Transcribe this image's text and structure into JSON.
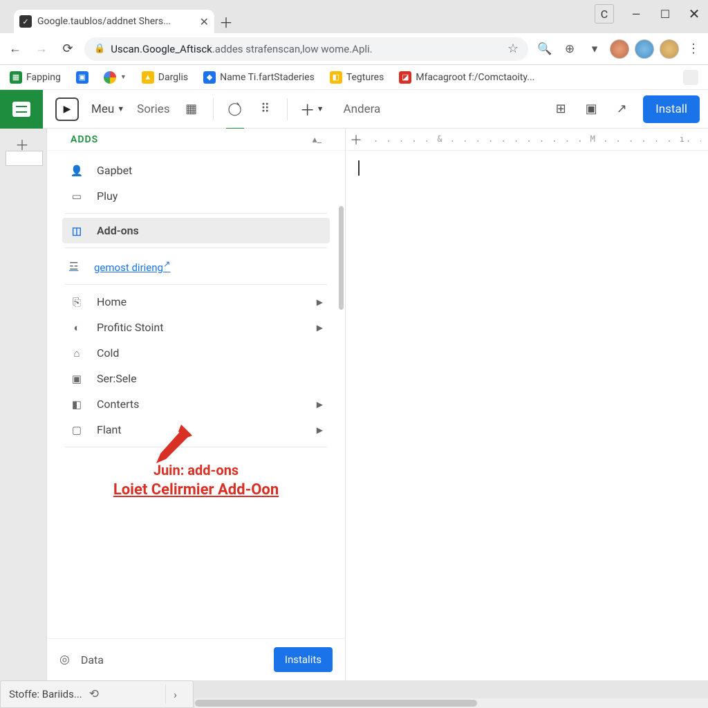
{
  "chrome": {
    "tab_title": "Google.taublos/addnet Shers...",
    "badge": "C",
    "url_prefix": "Uscan.Google_Aftisck",
    "url_suffix": ".addes strafenscan,low wome.Apli.",
    "bookmarks": [
      {
        "label": "Fapping",
        "bg": "#1e8e3e",
        "glyph": "▦"
      },
      {
        "label": "",
        "bg": "#1a73e8",
        "glyph": "▣"
      },
      {
        "label": "",
        "bg": "",
        "glyph": "G",
        "chev": true
      },
      {
        "label": "Darglis",
        "bg": "#fbbc04",
        "glyph": "▲"
      },
      {
        "label": "Name Ti.fartStaderies",
        "bg": "#1a73e8",
        "glyph": "◆"
      },
      {
        "label": "Tegtures",
        "bg": "#fbbc04",
        "glyph": "◧"
      },
      {
        "label": "Mfacagroot f:/Comctaoity...",
        "bg": "#d93025",
        "glyph": "◪"
      }
    ]
  },
  "toolbar": {
    "menu": "Meu",
    "sories": "Sories",
    "andera": "Andera",
    "install": "Install"
  },
  "panel": {
    "title": "ADDS",
    "items_top": [
      {
        "icon": "👤",
        "label": "Gapbet"
      },
      {
        "icon": "▭",
        "label": "Pluy"
      }
    ],
    "selected": {
      "icon": "◫",
      "label": "Add-ons"
    },
    "link": "gemost dirieng",
    "items": [
      {
        "icon": "⎘",
        "label": "Home",
        "chev": true
      },
      {
        "icon": "◐",
        "label": "Profitic Stoint",
        "chev": true
      },
      {
        "icon": "⌂",
        "label": "Cold",
        "chev": false
      },
      {
        "icon": "▣",
        "label": "Ser:Sele",
        "chev": false
      },
      {
        "icon": "◧",
        "label": "Conterts",
        "chev": true
      },
      {
        "icon": "▢",
        "label": "Flant",
        "chev": true
      }
    ],
    "callout_line1": "Juin: add-ons",
    "callout_line2": "Loiet Celirmier Add-Oon",
    "foot_label": "Data",
    "foot_button": "Instalits"
  },
  "ruler_ticks": ". . . . . & . . . . . . . . . . .  M . . . . . . ı. . . . .",
  "status": {
    "label": "Stoffe: Bariids..."
  }
}
